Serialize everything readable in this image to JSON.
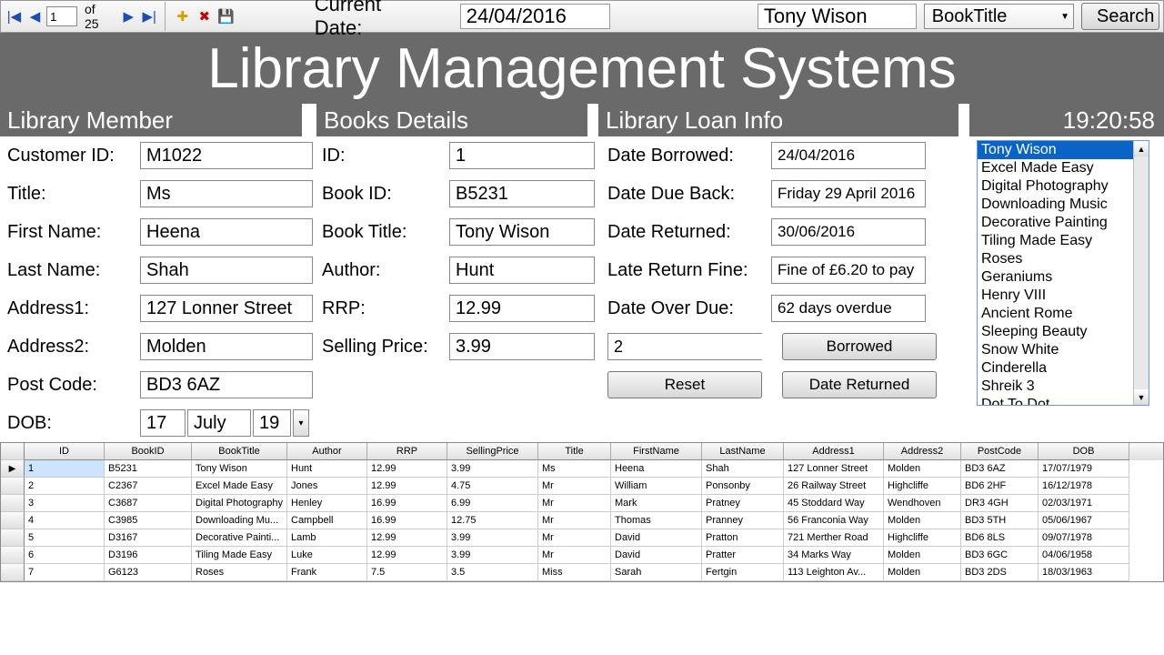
{
  "toolbar": {
    "page": "1",
    "of_text": "of 25",
    "current_date_label": "Current Date:",
    "current_date_value": "24/04/2016",
    "member_name": "Tony Wison",
    "sort_field": "BookTitle",
    "search_label": "Search"
  },
  "banner": "Library Management Systems",
  "headers": {
    "member": "Library Member",
    "books": "Books Details",
    "loan": "Library Loan Info",
    "clock": "19:20:58"
  },
  "member": {
    "labels": {
      "cust": "Customer ID:",
      "title": "Title:",
      "first": "First Name:",
      "last": "Last Name:",
      "addr1": "Address1:",
      "addr2": "Address2:",
      "post": "Post Code:",
      "dob": "DOB:"
    },
    "cust": "M1022",
    "title": "Ms",
    "first": "Heena",
    "last": "Shah",
    "addr1": "127 Lonner Street",
    "addr2": "Molden",
    "post": "BD3 6AZ",
    "dob_day": "17",
    "dob_month": "July",
    "dob_year": "19"
  },
  "book": {
    "labels": {
      "id": "ID:",
      "bookid": "Book ID:",
      "title": "Book Title:",
      "author": "Author:",
      "rrp": "RRP:",
      "sell": "Selling Price:"
    },
    "id": "1",
    "bookid": "B5231",
    "title": "Tony Wison",
    "author": "Hunt",
    "rrp": "12.99",
    "sell": "3.99"
  },
  "loan": {
    "labels": {
      "borrowed": "Date Borrowed:",
      "due": "Date Due Back:",
      "returned": "Date Returned:",
      "fine": "Late Return Fine:",
      "overdue": "Date Over Due:"
    },
    "borrowed": "24/04/2016",
    "due": "Friday 29 April 2016",
    "returned": "30/06/2016",
    "fine": "Fine of £6.20 to pay",
    "overdue": "62 days overdue",
    "qty": "2",
    "btn_borrowed": "Borrowed",
    "btn_reset": "Reset",
    "btn_date_returned": "Date Returned"
  },
  "listbox": {
    "items": [
      "Tony Wison",
      "Excel Made Easy",
      "Digital Photography",
      "Downloading Music",
      "Decorative Painting",
      "Tiling Made Easy",
      "Roses",
      "Geraniums",
      "Henry VIII",
      "Ancient Rome",
      "Sleeping Beauty",
      "Snow White",
      "Cinderella",
      "Shreik 3",
      "Dot To Dot"
    ],
    "selected": 0
  },
  "grid": {
    "cols": [
      "",
      "ID",
      "BookID",
      "BookTitle",
      "Author",
      "RRP",
      "SellingPrice",
      "Title",
      "FirstName",
      "LastName",
      "Address1",
      "Address2",
      "PostCode",
      "DOB"
    ],
    "widths": [
      26,
      88,
      96,
      105,
      88,
      88,
      100,
      80,
      100,
      90,
      110,
      85,
      85,
      100
    ],
    "rows": [
      [
        "1",
        "B5231",
        "Tony Wison",
        "Hunt",
        "12.99",
        "3.99",
        "Ms",
        "Heena",
        "Shah",
        "127 Lonner Street",
        "Molden",
        "BD3 6AZ",
        "17/07/1979"
      ],
      [
        "2",
        "C2367",
        "Excel Made Easy",
        "Jones",
        "12.99",
        "4.75",
        "Mr",
        "William",
        "Ponsonby",
        "26 Railway Street",
        "Highcliffe",
        "BD6 2HF",
        "16/12/1978"
      ],
      [
        "3",
        "C3687",
        "Digital Photography",
        "Henley",
        "16.99",
        "6.99",
        "Mr",
        "Mark",
        "Pratney",
        "45 Stoddard Way",
        "Wendhoven",
        "DR3 4GH",
        "02/03/1971"
      ],
      [
        "4",
        "C3985",
        "Downloading Mu...",
        "Campbell",
        "16.99",
        "12.75",
        "Mr",
        "Thomas",
        "Pranney",
        "56 Franconia Way",
        "Molden",
        "BD3 5TH",
        "05/06/1967"
      ],
      [
        "5",
        "D3167",
        "Decorative Painti...",
        "Lamb",
        "12.99",
        "3.99",
        "Mr",
        "David",
        "Pratton",
        "721 Merther Road",
        "Highcliffe",
        "BD6 8LS",
        "09/07/1978"
      ],
      [
        "6",
        "D3196",
        "Tiling Made Easy",
        "Luke",
        "12.99",
        "3.99",
        "Mr",
        "David",
        "Pratter",
        "34 Marks Way",
        "Molden",
        "BD3 6GC",
        "04/06/1958"
      ],
      [
        "7",
        "G6123",
        "Roses",
        "Frank",
        "7.5",
        "3.5",
        "Miss",
        "Sarah",
        "Fertgin",
        "113 Leighton Av...",
        "Molden",
        "BD3 2DS",
        "18/03/1963"
      ]
    ]
  }
}
